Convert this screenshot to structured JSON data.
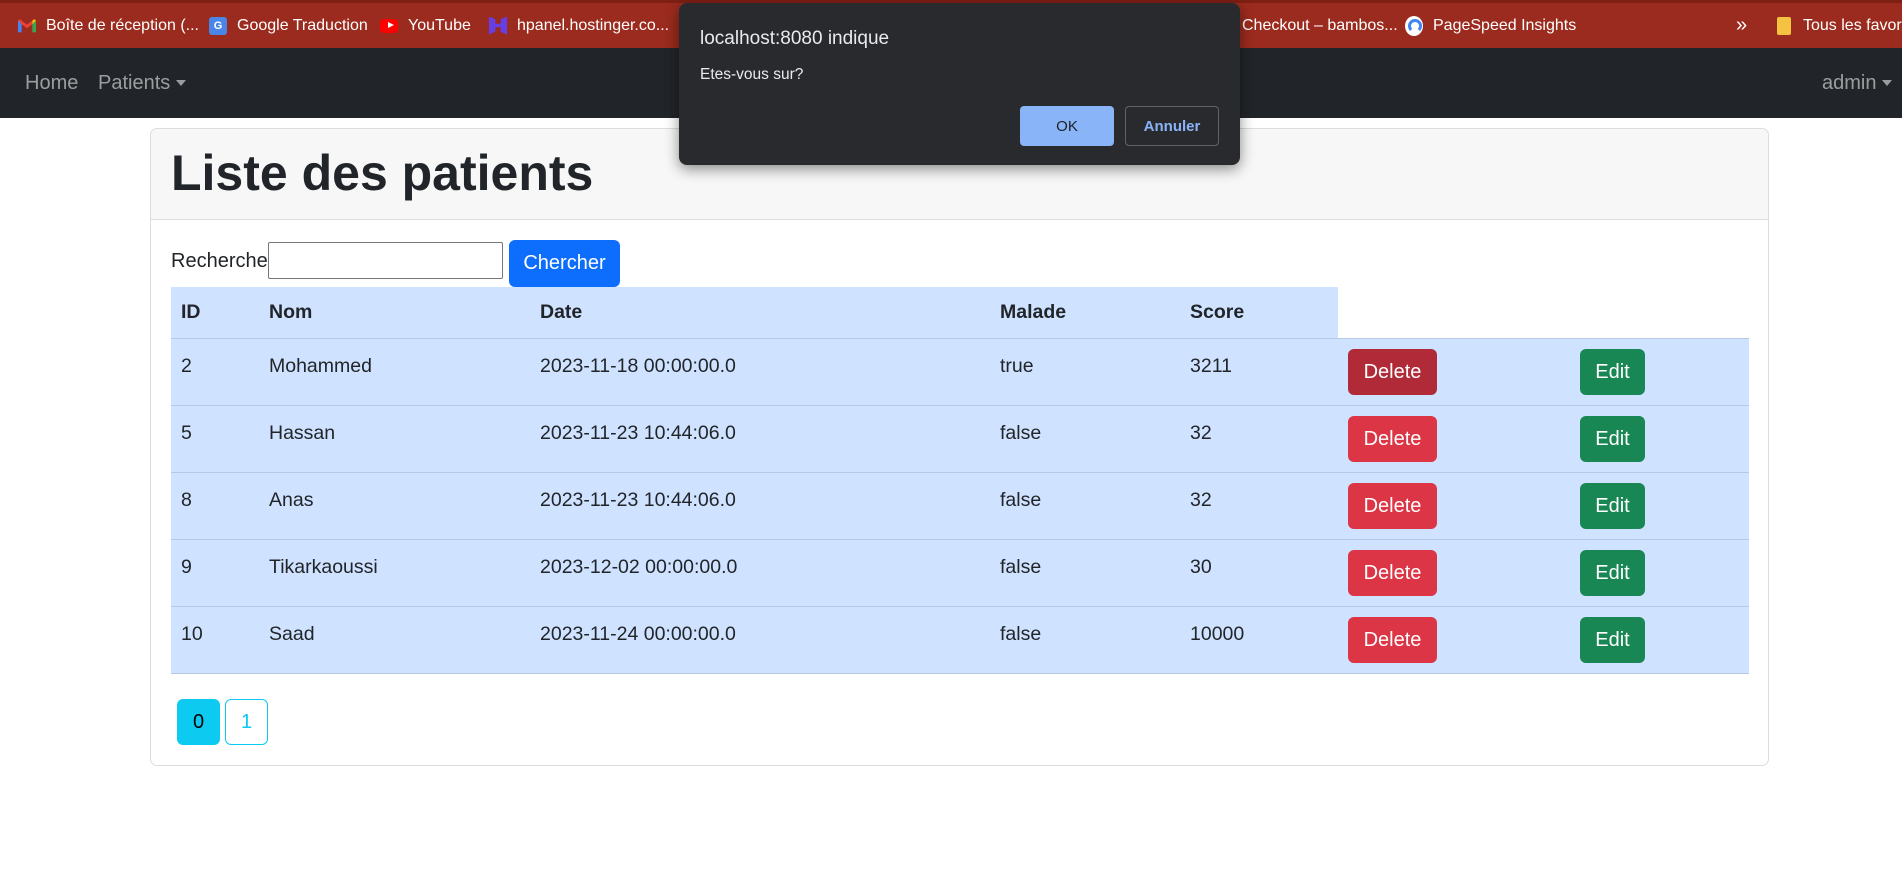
{
  "bookmarks": [
    {
      "label": "Boîte de réception (...",
      "icon": "gmail-icon"
    },
    {
      "label": "Google Traduction",
      "icon": "google-translate-icon"
    },
    {
      "label": "YouTube",
      "icon": "youtube-icon"
    },
    {
      "label": "hpanel.hostinger.co...",
      "icon": "hostinger-icon"
    },
    {
      "label": "Checkout – bambos...",
      "icon": "page-icon"
    },
    {
      "label": "PageSpeed Insights",
      "icon": "pagespeed-icon"
    }
  ],
  "bookmarks_more": "»",
  "all_bookmarks": "Tous les favoris",
  "navbar": {
    "home": "Home",
    "patients": "Patients",
    "user": "admin"
  },
  "page": {
    "title": "Liste des patients"
  },
  "search": {
    "label": "Recherche",
    "value": "",
    "button": "Chercher"
  },
  "table": {
    "headers": [
      "ID",
      "Nom",
      "Date",
      "Malade",
      "Score"
    ],
    "delete_label": "Delete",
    "edit_label": "Edit",
    "rows": [
      {
        "id": "2",
        "nom": "Mohammed",
        "date": "2023-11-18 00:00:00.0",
        "malade": "true",
        "score": "3211"
      },
      {
        "id": "5",
        "nom": "Hassan",
        "date": "2023-11-23 10:44:06.0",
        "malade": "false",
        "score": "32"
      },
      {
        "id": "8",
        "nom": "Anas",
        "date": "2023-11-23 10:44:06.0",
        "malade": "false",
        "score": "32"
      },
      {
        "id": "9",
        "nom": "Tikarkaoussi",
        "date": "2023-12-02 00:00:00.0",
        "malade": "false",
        "score": "30"
      },
      {
        "id": "10",
        "nom": "Saad",
        "date": "2023-11-24 00:00:00.0",
        "malade": "false",
        "score": "10000"
      }
    ]
  },
  "pagination": {
    "pages": [
      "0",
      "1"
    ],
    "current": "0"
  },
  "dialog": {
    "title": "localhost:8080 indique",
    "message": "Etes-vous sur?",
    "ok": "OK",
    "cancel": "Annuler"
  },
  "colors": {
    "bookmark_bar": "#9b2b1e",
    "navbar": "#212529",
    "table_row": "#cfe2ff",
    "delete": "#dc3545",
    "edit": "#198754",
    "primary": "#0d6efd",
    "info": "#0dcaf0",
    "dialog_bg": "#292a2d",
    "dialog_accent": "#8ab4f8"
  }
}
